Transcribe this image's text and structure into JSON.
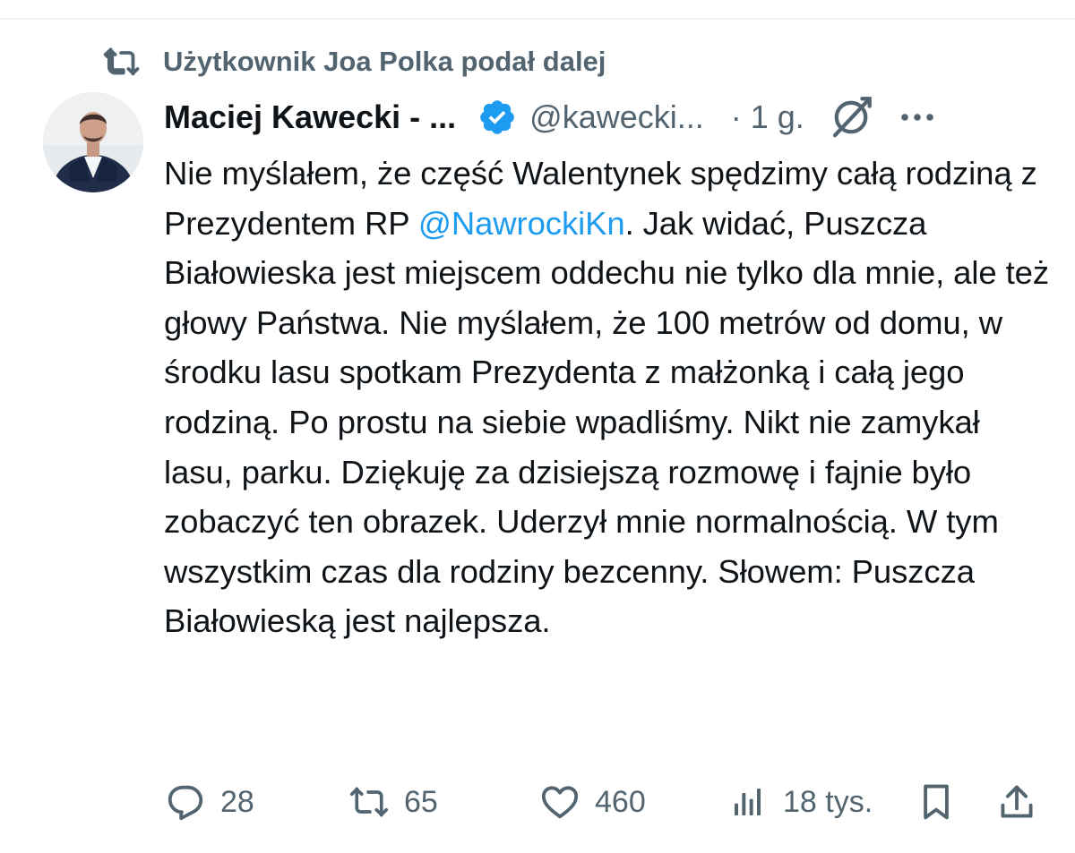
{
  "repost_banner": {
    "text": "Użytkownik Joa Polka podał dalej",
    "icon": "repost-icon"
  },
  "tweet": {
    "author_name": "Maciej Kawecki - ...",
    "verified": true,
    "verified_color": "#1d9bf0",
    "handle": "@kawecki...",
    "time": "· 1 g.",
    "grok_icon": "grok-icon",
    "more_icon": "more-icon",
    "text_parts": {
      "before_mention": "Nie myślałem, że część Walentynek spędzimy całą rodziną z Prezydentem RP ",
      "mention": "@NawrockiKn",
      "after_mention": ". Jak widać, Puszcza Białowieska jest miejscem oddechu nie tylko dla mnie, ale też głowy Państwa. Nie myślałem, że 100 metrów od domu, w środku lasu spotkam Prezydenta z małżonką i całą jego rodziną. Po prostu na siebie wpadliśmy. Nikt nie zamykał lasu, parku. Dziękuję za dzisiejszą rozmowę i fajnie było zobaczyć ten obrazek. Uderzył mnie normalnością. W tym wszystkim czas dla rodziny bezcenny. Słowem: Puszcza Białowieską jest najlepsza."
    },
    "mention_color": "#1d9bf0"
  },
  "actions": {
    "reply_count": "28",
    "repost_count": "65",
    "like_count": "460",
    "views_count": "18 tys.",
    "icons": [
      "reply-icon",
      "repost-icon",
      "like-icon",
      "views-icon",
      "bookmark-icon",
      "share-icon"
    ]
  },
  "colors": {
    "text_primary": "#0f1419",
    "text_secondary": "#536471",
    "accent": "#1d9bf0"
  }
}
